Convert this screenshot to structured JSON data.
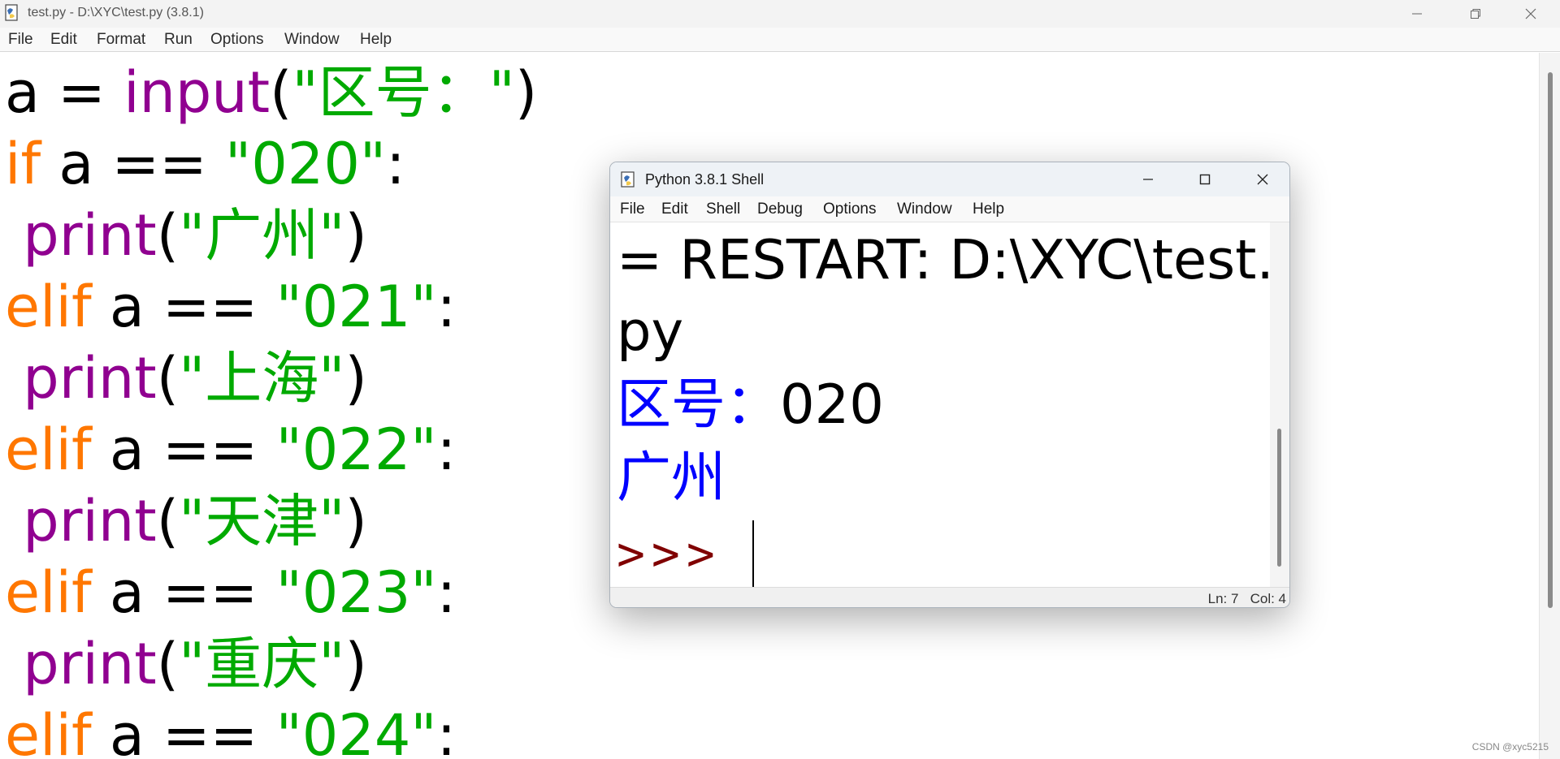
{
  "editor_window": {
    "title": "test.py - D:\\XYC\\test.py (3.8.1)",
    "menu": [
      "File",
      "Edit",
      "Format",
      "Run",
      "Options",
      "Window",
      "Help"
    ],
    "code": {
      "line1": {
        "a": "a = ",
        "b": "input",
        "c": "(",
        "d": "\"区号：\"",
        "e": ")"
      },
      "line2": {
        "a": "if",
        "b": " a == ",
        "c": "\"020\"",
        "d": ":"
      },
      "line3": {
        "a": " ",
        "b": "print",
        "c": "(",
        "d": "\"广州\"",
        "e": ")"
      },
      "line4": {
        "a": "elif",
        "b": " a == ",
        "c": "\"021\"",
        "d": ":"
      },
      "line5": {
        "a": " ",
        "b": "print",
        "c": "(",
        "d": "\"上海\"",
        "e": ")"
      },
      "line6": {
        "a": "elif",
        "b": " a == ",
        "c": "\"022\"",
        "d": ":"
      },
      "line7": {
        "a": " ",
        "b": "print",
        "c": "(",
        "d": "\"天津\"",
        "e": ")"
      },
      "line8": {
        "a": "elif",
        "b": " a == ",
        "c": "\"023\"",
        "d": ":"
      },
      "line9": {
        "a": " ",
        "b": "print",
        "c": "(",
        "d": "\"重庆\"",
        "e": ")"
      },
      "line10": {
        "a": "elif",
        "b": " a == ",
        "c": "\"024\"",
        "d": ":"
      }
    },
    "watermark": "CSDN @xyc5215"
  },
  "shell_window": {
    "title": "Python 3.8.1 Shell",
    "menu": [
      "File",
      "Edit",
      "Shell",
      "Debug",
      "Options",
      "Window",
      "Help"
    ],
    "output": {
      "restart_1": "= RESTART: D:\\XYC\\test.",
      "restart_2": "py",
      "prompt_text": "区号：",
      "user_input": "020",
      "result": "广州",
      "repl_prompt": ">>>"
    },
    "status": "Ln: 7   Col: 4"
  },
  "colors": {
    "keyword": "#ff7700",
    "builtin": "#900090",
    "string": "#00aa00",
    "stdin": "#0000ff",
    "prompt": "#800000"
  }
}
